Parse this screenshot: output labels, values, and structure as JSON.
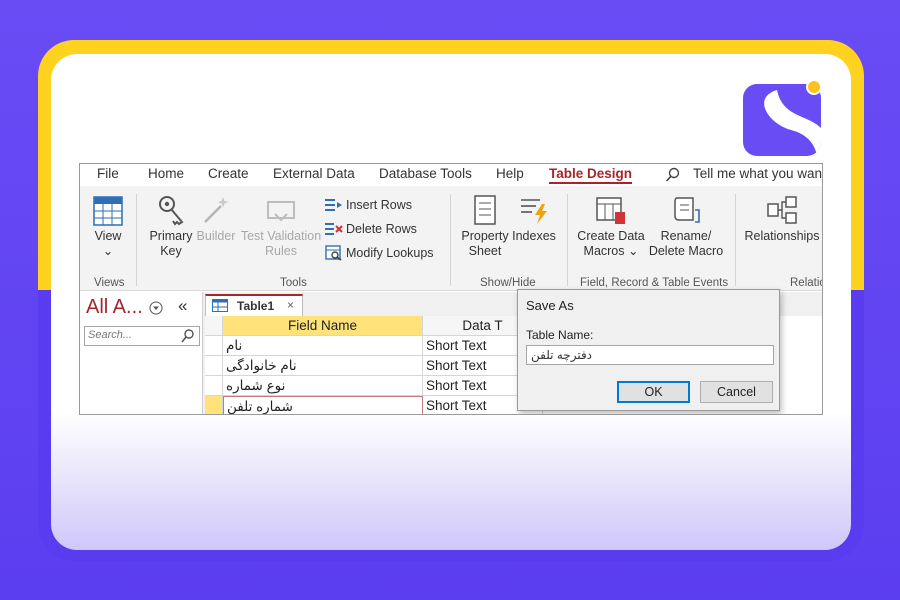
{
  "colors": {
    "accent": "#a4262c",
    "brand_purple": "#6a4cf5",
    "brand_yellow": "#ffd21f",
    "field_header_selected": "#ffe27a"
  },
  "menu": {
    "items": [
      "File",
      "Home",
      "Create",
      "External Data",
      "Database Tools",
      "Help",
      "Table Design"
    ],
    "active": "Table Design",
    "tellme": "Tell me what you wan"
  },
  "ribbon": {
    "views": {
      "view_label": "View",
      "view_arrow": "⌄",
      "group_label": "Views"
    },
    "tools": {
      "primary_key": [
        "Primary",
        "Key"
      ],
      "builder": "Builder",
      "test_validation": [
        "Test Validation",
        "Rules"
      ],
      "insert_rows": "Insert Rows",
      "delete_rows": "Delete Rows",
      "modify_lookups": "Modify Lookups",
      "group_label": "Tools"
    },
    "show_hide": {
      "property_sheet": [
        "Property",
        "Sheet"
      ],
      "indexes": "Indexes",
      "group_label": "Show/Hide"
    },
    "events": {
      "create_data_macros": [
        "Create Data",
        "Macros ⌄"
      ],
      "rename_delete_macro": [
        "Rename/",
        "Delete Macro"
      ],
      "group_label": "Field, Record & Table Events"
    },
    "relationships": {
      "label": "Relationships",
      "group_label": "Relatio"
    }
  },
  "nav": {
    "title": "All A...",
    "collapse": "«",
    "search_placeholder": "Search..."
  },
  "document": {
    "tab_label": "Table1",
    "tab_close": "×",
    "columns": [
      "Field Name",
      "Data T"
    ],
    "rows": [
      {
        "field": "نام",
        "type": "Short Text"
      },
      {
        "field": "نام خانوادگی",
        "type": "Short Text"
      },
      {
        "field": "نوع شماره",
        "type": "Short Text"
      },
      {
        "field": "شماره تلفن",
        "type": "Short Text"
      }
    ]
  },
  "dialog": {
    "title": "Save As",
    "label": "Table Name:",
    "value": "دفترچه تلفن",
    "ok": "OK",
    "cancel": "Cancel"
  }
}
